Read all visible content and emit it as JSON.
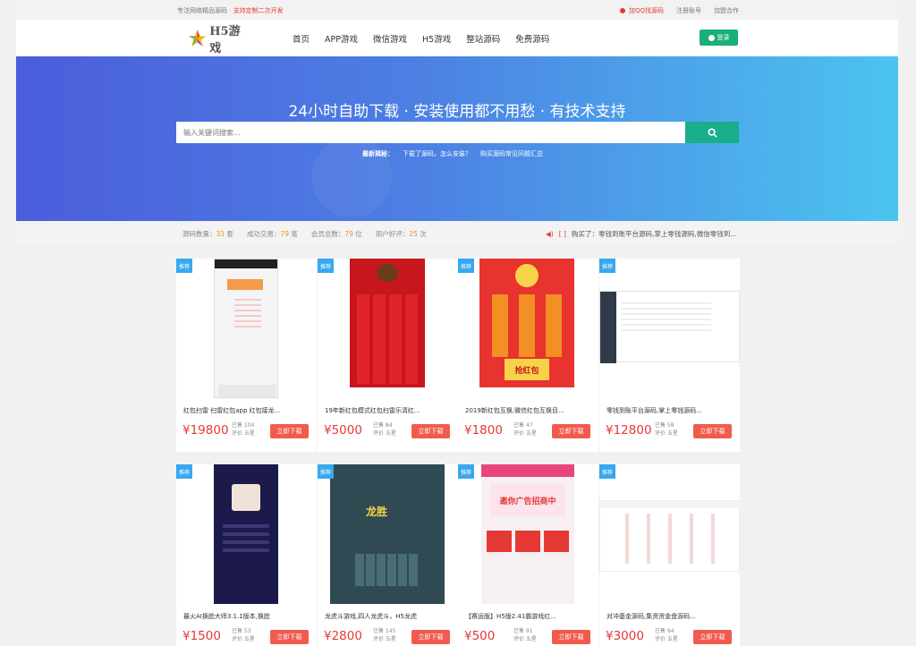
{
  "topbar": {
    "left_text": "专注网络精品源码 · ",
    "left_highlight": "支持定制二次开发",
    "qq": "加QQ找源码",
    "register": "注册账号",
    "join": "加盟合作"
  },
  "header": {
    "logo_text": "H5游戏",
    "nav": [
      "首页",
      "APP游戏",
      "微信游戏",
      "H5游戏",
      "整站源码",
      "免费源码"
    ],
    "login": "登录"
  },
  "banner": {
    "headline": "24小时自助下载 · 安装使用都不用愁 · 有技术支持",
    "search_placeholder": "输入关键词搜索...",
    "hot_label": "最新揭秘：",
    "hot_links": [
      "下载了源码，怎么安装？",
      "购买源码常见问题汇总"
    ]
  },
  "stats": {
    "items": [
      {
        "label": "源码数量：",
        "value": "33",
        "unit": " 套"
      },
      {
        "label": "成功交易：",
        "value": "79",
        "unit": " 笔"
      },
      {
        "label": "会员总数：",
        "value": "79",
        "unit": " 位"
      },
      {
        "label": "用户好评：",
        "value": "25",
        "unit": " 次"
      }
    ],
    "notice": "购买了：零钱到账平台源码,掌上零钱源码,微信零钱到..."
  },
  "cards": [
    {
      "badge": "推荐",
      "title": "红包扫雷 扫雷红包app 红包接龙...",
      "price": "¥19800",
      "sales": "已售 104",
      "rating": "评价 五星",
      "button": "立即下载"
    },
    {
      "badge": "推荐",
      "title": "19年新红包模式红包扫雷乐清红...",
      "price": "¥5000",
      "sales": "已售 84",
      "rating": "评价 五星",
      "button": "立即下载"
    },
    {
      "badge": "推荐",
      "title": "2019新红包互换,微信红包互换目...",
      "price": "¥1800",
      "sales": "已售 47",
      "rating": "评价 五星",
      "button": "立即下载"
    },
    {
      "badge": "推荐",
      "title": "零钱到账平台源码,掌上零钱源码...",
      "price": "¥12800",
      "sales": "已售 58",
      "rating": "评价 五星",
      "button": "立即下载"
    },
    {
      "badge": "推荐",
      "title": "最火AI换脸大师3.1.1版本,换脸",
      "price": "¥1500",
      "sales": "已售 53",
      "rating": "评价 五星",
      "button": "立即下载"
    },
    {
      "badge": "推荐",
      "title": "龙虎斗游戏,四人龙虎斗，H5龙虎",
      "price": "¥2800",
      "sales": "已售 145",
      "rating": "评价 五星",
      "button": "立即下载"
    },
    {
      "badge": "推荐",
      "title": "【赛运版】H5版2.41霸游戏红...",
      "price": "¥500",
      "sales": "已售 91",
      "rating": "评价 五星",
      "button": "立即下载"
    },
    {
      "badge": "推荐",
      "title": "对冲基金源码,集资资金盘源码...",
      "price": "¥3000",
      "sales": "已售 94",
      "rating": "评价 五星",
      "button": "立即下载"
    }
  ],
  "shot_text": {
    "c2_win": "龙胜",
    "c3_grab": "抢红包",
    "c7_banner": "邀你广告招商中"
  },
  "colors": {
    "accent": "#1aae8b",
    "price": "#e53935",
    "badge": "#38a8ef",
    "download": "#f15b4e"
  }
}
